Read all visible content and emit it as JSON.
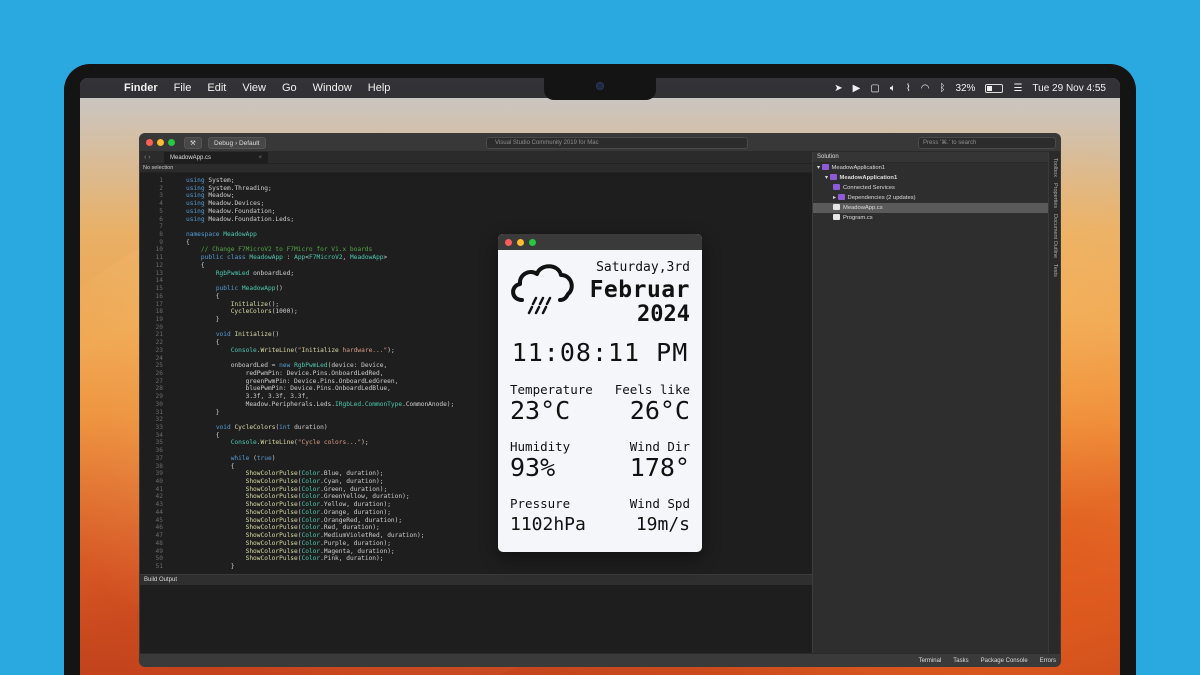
{
  "menubar": {
    "apple": "",
    "items": [
      "Finder",
      "File",
      "Edit",
      "View",
      "Go",
      "Window",
      "Help"
    ],
    "battery": "32%",
    "datetime": "Tue 29 Nov  4:55"
  },
  "ide": {
    "config": "Debug",
    "target": "Default",
    "title": "Visual Studio Community 2019 for Mac",
    "search_placeholder": "Press '⌘.' to search",
    "tab_label": "MeadowApp.cs",
    "selection": "No selection",
    "build_output": "Build Output",
    "solution_title": "Solution",
    "tree": [
      {
        "label": "MeadowApplication1",
        "indent": 0
      },
      {
        "label": "MeadowApplication1",
        "indent": 1
      },
      {
        "label": "Connected Services",
        "indent": 2
      },
      {
        "label": "Dependencies (2 updates)",
        "indent": 2
      },
      {
        "label": "MeadowApp.cs",
        "indent": 2
      },
      {
        "label": "Program.cs",
        "indent": 2
      }
    ],
    "side_tabs": [
      "Toolbox",
      "Properties",
      "Document Outline",
      "Tests"
    ],
    "status": [
      "Terminal",
      "Tasks",
      "Package Console",
      "Errors"
    ],
    "code": [
      "using System;",
      "using System.Threading;",
      "using Meadow;",
      "using Meadow.Devices;",
      "using Meadow.Foundation;",
      "using Meadow.Foundation.Leds;",
      "",
      "namespace MeadowApp",
      "{",
      "    // Change F7MicroV2 to F7Micro for V1.x boards",
      "    public class MeadowApp : App<F7MicroV2, MeadowApp>",
      "    {",
      "        RgbPwmLed onboardLed;",
      "",
      "        public MeadowApp()",
      "        {",
      "            Initialize();",
      "            CycleColors(1000);",
      "        }",
      "",
      "        void Initialize()",
      "        {",
      "            Console.WriteLine(\"Initialize hardware...\");",
      "",
      "            onboardLed = new RgbPwmLed(device: Device,",
      "                redPwmPin: Device.Pins.OnboardLedRed,",
      "                greenPwmPin: Device.Pins.OnboardLedGreen,",
      "                bluePwmPin: Device.Pins.OnboardLedBlue,",
      "                3.3f, 3.3f, 3.3f,",
      "                Meadow.Peripherals.Leds.IRgbLed.CommonType.CommonAnode);",
      "        }",
      "",
      "        void CycleColors(int duration)",
      "        {",
      "            Console.WriteLine(\"Cycle colors...\");",
      "",
      "            while (true)",
      "            {",
      "                ShowColorPulse(Color.Blue, duration);",
      "                ShowColorPulse(Color.Cyan, duration);",
      "                ShowColorPulse(Color.Green, duration);",
      "                ShowColorPulse(Color.GreenYellow, duration);",
      "                ShowColorPulse(Color.Yellow, duration);",
      "                ShowColorPulse(Color.Orange, duration);",
      "                ShowColorPulse(Color.OrangeRed, duration);",
      "                ShowColorPulse(Color.Red, duration);",
      "                ShowColorPulse(Color.MediumVioletRed, duration);",
      "                ShowColorPulse(Color.Purple, duration);",
      "                ShowColorPulse(Color.Magenta, duration);",
      "                ShowColorPulse(Color.Pink, duration);",
      "            }"
    ]
  },
  "weather": {
    "day": "Saturday,3rd",
    "month": "Februar",
    "year": "2024",
    "time": "11:08:11 PM",
    "temperature_label": "Temperature",
    "temperature": "23°C",
    "feels_label": "Feels like",
    "feels": "26°C",
    "humidity_label": "Humidity",
    "humidity": "93%",
    "wind_dir_label": "Wind Dir",
    "wind_dir": "178°",
    "pressure_label": "Pressure",
    "pressure": "1102hPa",
    "wind_spd_label": "Wind Spd",
    "wind_spd": "19m/s"
  },
  "colors": {
    "background": "#2aa8e0",
    "keyword": "#569cd6",
    "type": "#4ec9b0",
    "string": "#d69d85",
    "comment": "#57a64a",
    "method": "#dcdcaa"
  }
}
